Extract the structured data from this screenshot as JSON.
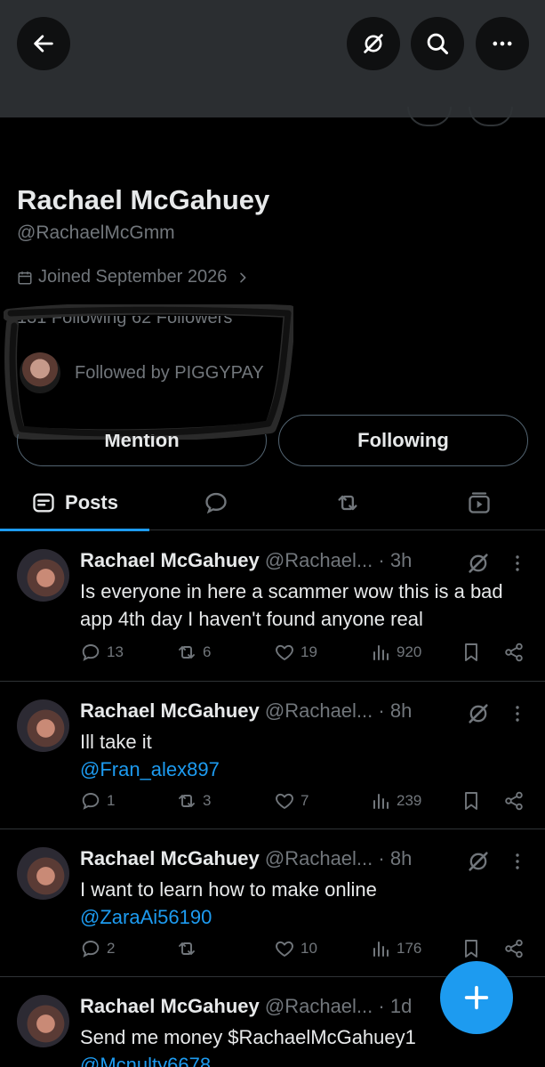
{
  "header": {
    "back_icon": "arrow-left-icon",
    "grok_icon": "grok-icon",
    "search_icon": "search-icon",
    "more_icon": "more-icon"
  },
  "profile": {
    "name": "Rachael McGahuey",
    "handle": "@RachaelMcGmm",
    "joined": "Joined September 2026",
    "stats_partial": "131 Following 62 Followers",
    "followed_by": "Followed by PIGGYPAY",
    "mention_label": "Mention",
    "following_label": "Following"
  },
  "tabs": [
    {
      "label": "Posts",
      "icon": "posts-icon",
      "selected": true
    },
    {
      "label": "",
      "icon": "replies-icon"
    },
    {
      "label": "",
      "icon": "reposts-icon"
    },
    {
      "label": "",
      "icon": "media-icon"
    }
  ],
  "posts": [
    {
      "name": "Rachael McGahuey",
      "handle": "@Rachael...",
      "time": "· 3h",
      "text": "Is everyone in here a scammer wow this is a bad app 4th day I haven't found anyone real",
      "link": "",
      "replies": "13",
      "reposts": "6",
      "likes": "19",
      "views": "920"
    },
    {
      "name": "Rachael McGahuey",
      "handle": "@Rachael...",
      "time": "· 8h",
      "text": "Ill take it",
      "link": "@Fran_alex897",
      "replies": "1",
      "reposts": "3",
      "likes": "7",
      "views": "239"
    },
    {
      "name": "Rachael McGahuey",
      "handle": "@Rachael...",
      "time": "· 8h",
      "text": "I want to learn how to make online",
      "link": "@ZaraAi56190",
      "replies": "2",
      "reposts": "",
      "likes": "10",
      "views": "176"
    },
    {
      "name": "Rachael McGahuey",
      "handle": "@Rachael...",
      "time": "· 1d",
      "text": "Send me money $RachaelMcGahuey1",
      "link": "@Mcnulty6678",
      "replies": "",
      "reposts": "",
      "likes": "",
      "views": ""
    }
  ],
  "compose_icon": "plus-icon",
  "colors": {
    "accent": "#1d9bf0",
    "muted": "#71767b",
    "text": "#e7e9ea",
    "background": "#000000",
    "banner": "#2b2e31"
  }
}
